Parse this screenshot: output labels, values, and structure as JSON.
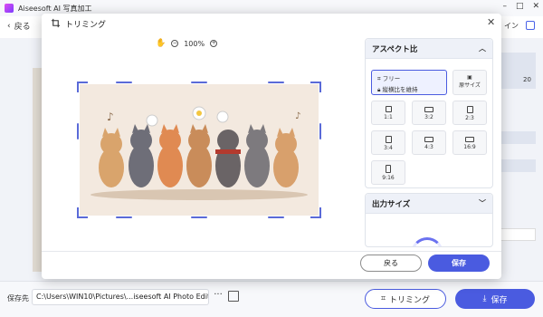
{
  "app": {
    "title": "Aiseesoft AI 写真加工",
    "window_controls": [
      "–",
      "□",
      "✕"
    ]
  },
  "background": {
    "back_label": "戻る",
    "right_text": "イン",
    "side_value": "20"
  },
  "modal": {
    "title": "トリミング",
    "close": "✕",
    "zoom_level": "100%",
    "zoom_out": "−",
    "zoom_in": "+",
    "back_button": "戻る",
    "save_button": "保存"
  },
  "aspect": {
    "heading": "アスペクト比",
    "free_label": "フリー",
    "lock_label": "縦横比を維持",
    "original_label": "原サイズ",
    "ratios": [
      "1:1",
      "3:2",
      "2:3",
      "3:4",
      "4:3",
      "16:9",
      "9:16"
    ]
  },
  "output": {
    "heading": "出力サイズ"
  },
  "bottom": {
    "save_to_label": "保存先",
    "save_path": "C:\\Users\\WIN10\\Pictures\\...iseesoft AI Photo Editor",
    "more": "···",
    "trim_button": "トリミング",
    "save_button": "保存"
  }
}
